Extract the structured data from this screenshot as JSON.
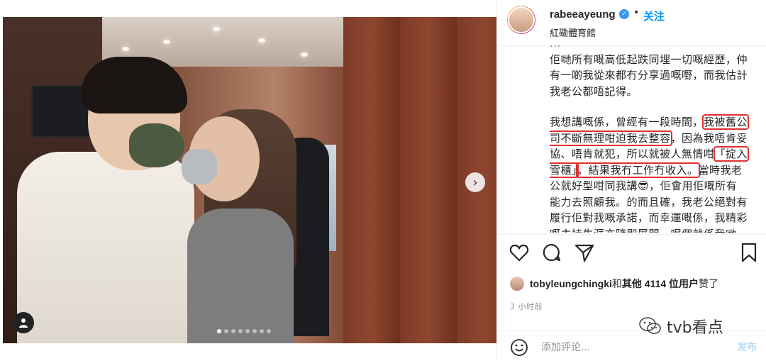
{
  "post": {
    "username": "rabeeayeung",
    "separator": "•",
    "follow_label": "关注",
    "location": "紅磡體育館"
  },
  "caption": {
    "p1_line0": "...",
    "p1_line1": "佢哋所有嘅高低起跌同埋一切嘅經歷，仲",
    "p1_line2": "有一啲我從來都冇分享過嘅嘢，而我估計",
    "p1_line3": "我老公都唔記得。",
    "p2_a": "我想講嘅係，曾經有一段時間，",
    "p2_hl1a": "我被舊公",
    "p2_hl1b": "司不斷無理咁迫我去整容",
    "p2_b": "，因為我唔肯妥",
    "p2_c": "協、唔肯就犯，所以就被人無情咁",
    "p2_hl2a": "「掟入",
    "p2_hl2b": "雪櫃」",
    "p2_hl3": "，結果我冇工作冇收入。",
    "p2_d": "當時我老",
    "p2_e": "公就好型咁同我講😎，佢會用佢嘅所有",
    "p2_f": "能力去照顧我。的而且確，我老公絕對有",
    "p2_g": "履行佢對我嘅承諾，而幸運嘅係，我精彩",
    "p2_h": "嘅主持生涯亦隨即展開。呢個就係我哋"
  },
  "likes": {
    "user": "tobyleungchingki",
    "and": " 和 ",
    "others": "其他 4114 位用户",
    "suffix": " 赞了"
  },
  "timestamp": "3 小时前",
  "comment": {
    "placeholder": "添加评论...",
    "post_label": "发布"
  },
  "watermark": {
    "text": "tvb看点"
  },
  "carousel": {
    "next_icon": "›",
    "slide_count": 8,
    "active_index": 0
  }
}
